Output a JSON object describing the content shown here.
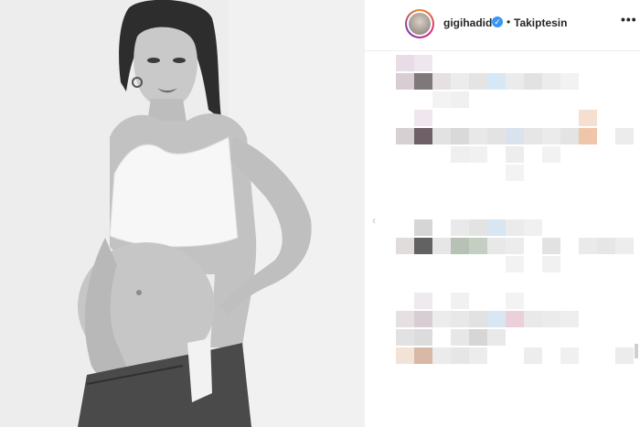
{
  "header": {
    "username": "gigihadid",
    "dot": "•",
    "follow_label": "Takiptesin",
    "more_label": "•••",
    "verified_glyph": "✓"
  },
  "photo": {
    "description_icon": "photo"
  },
  "navigation": {
    "prev_glyph": "‹"
  }
}
